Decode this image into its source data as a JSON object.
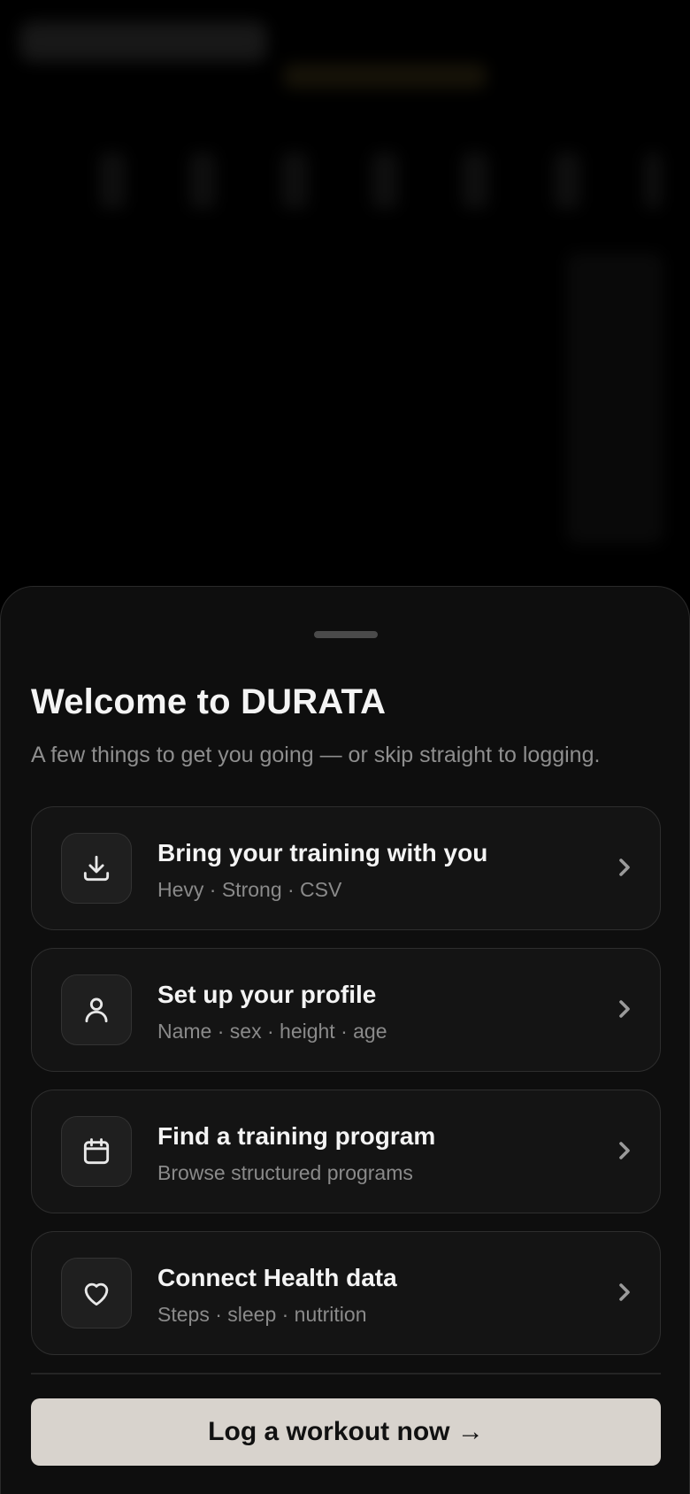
{
  "welcome": {
    "title": "Welcome to DURATA",
    "subtitle": "A few things to get you going — or skip straight to logging."
  },
  "options": [
    {
      "title": "Bring your training with you",
      "subtitle": "Hevy · Strong · CSV",
      "icon": "download-icon"
    },
    {
      "title": "Set up your profile",
      "subtitle": "Name · sex · height · age",
      "icon": "user-icon"
    },
    {
      "title": "Find a training program",
      "subtitle": "Browse structured programs",
      "icon": "calendar-icon"
    },
    {
      "title": "Connect Health data",
      "subtitle": "Steps · sleep · nutrition",
      "icon": "heart-icon"
    }
  ],
  "cta": {
    "label": "Log a workout now →"
  },
  "colors": {
    "background": "#000000",
    "sheet": "#0e0e0e",
    "card": "#141414",
    "cta_background": "#d8d3cd",
    "muted_text": "#8a8a8a"
  }
}
